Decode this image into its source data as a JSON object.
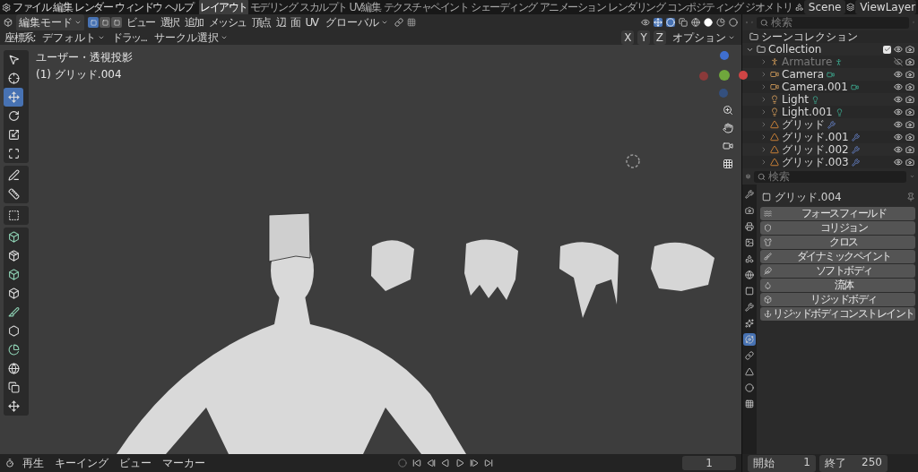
{
  "topbar": {
    "menus": [
      "ファイル",
      "編集",
      "レンダー",
      "ウィンドウ",
      "ヘルプ"
    ],
    "workspaces": [
      {
        "label": "レイアウト",
        "selected": true
      },
      {
        "label": "モデリング",
        "selected": false
      },
      {
        "label": "スカルプト",
        "selected": false
      },
      {
        "label": "UV編集",
        "selected": false
      },
      {
        "label": "テクスチャペイント",
        "selected": false
      },
      {
        "label": "シェーディング",
        "selected": false
      },
      {
        "label": "アニメーション",
        "selected": false
      },
      {
        "label": "レンダリング",
        "selected": false
      },
      {
        "label": "コンポジティング",
        "selected": false
      },
      {
        "label": "ジオメトリ",
        "selected": false
      }
    ],
    "scene": "Scene",
    "view_layer": "ViewLayer"
  },
  "viewport_header": {
    "mode": "編集モード",
    "select_modes": [
      {
        "selected": true
      },
      {
        "selected": false
      },
      {
        "selected": false
      }
    ],
    "menus": [
      "ビュー",
      "選択",
      "追加",
      "メッシュ",
      "頂点",
      "辺",
      "面",
      "UV"
    ],
    "orientation": "グローバル"
  },
  "tool_settings": {
    "label": "座標系:",
    "orientation": "デフォルト",
    "drag": "ドラッ...",
    "select_tool": "サークル選択",
    "axes": [
      "X",
      "Y",
      "Z"
    ],
    "options": "オプション"
  },
  "viewport": {
    "view_name": "ユーザー・透視投影",
    "object_label": "(1) グリッド.004",
    "tool_groups": [
      [
        {
          "selected": false
        },
        {
          "selected": false
        },
        {
          "selected": true
        },
        {
          "selected": false
        },
        {
          "selected": false
        },
        {
          "selected": false
        }
      ],
      [
        {
          "selected": false
        },
        {
          "selected": false
        }
      ],
      [
        {
          "selected": false
        }
      ],
      [
        {
          "selected": false
        },
        {
          "selected": false
        },
        {
          "selected": false
        },
        {
          "selected": false
        },
        {
          "selected": false
        },
        {
          "selected": false
        },
        {
          "selected": false
        },
        {
          "selected": false
        },
        {
          "selected": false
        },
        {
          "selected": false
        }
      ]
    ]
  },
  "outliner": {
    "search_placeholder": "検索",
    "root": "シーンコレクション",
    "collection": {
      "name": "Collection",
      "expanded": true,
      "checked": true,
      "children": [
        {
          "name": "Armature",
          "kind": "armature",
          "hidden": true
        },
        {
          "name": "Camera",
          "kind": "camera",
          "hidden": false
        },
        {
          "name": "Camera.001",
          "kind": "camera",
          "hidden": false
        },
        {
          "name": "Light",
          "kind": "light",
          "hidden": false
        },
        {
          "name": "Light.001",
          "kind": "light",
          "hidden": false
        },
        {
          "name": "グリッド",
          "kind": "mesh",
          "hidden": false
        },
        {
          "name": "グリッド.001",
          "kind": "mesh",
          "hidden": false
        },
        {
          "name": "グリッド.002",
          "kind": "mesh",
          "hidden": false
        },
        {
          "name": "グリッド.003",
          "kind": "mesh",
          "hidden": false
        }
      ]
    }
  },
  "properties": {
    "search_placeholder": "検索",
    "tabs": [
      {
        "selected": false
      },
      {
        "selected": false
      },
      {
        "selected": false
      },
      {
        "selected": false
      },
      {
        "selected": false
      },
      {
        "selected": false
      },
      {
        "selected": false
      },
      {
        "selected": false
      },
      {
        "selected": false
      },
      {
        "selected": true
      },
      {
        "selected": false
      },
      {
        "selected": false
      },
      {
        "selected": false
      },
      {
        "selected": false
      }
    ],
    "object_name": "グリッド.004",
    "buttons": [
      "フォースフィールド",
      "コリジョン",
      "クロス",
      "ダイナミックペイント",
      "ソフトボディ",
      "流体",
      "リジッドボディ",
      "リジッドボディコンストレイント"
    ]
  },
  "timeline": {
    "menus": [
      "再生",
      "キーイング",
      "ビュー",
      "マーカー"
    ],
    "current_frame": "1",
    "start_label": "開始",
    "start": "1",
    "end_label": "終了",
    "end": "250"
  }
}
